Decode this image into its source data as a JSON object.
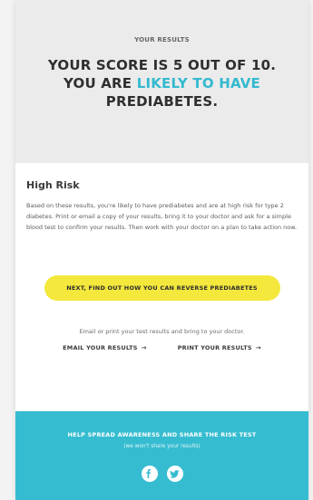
{
  "hero": {
    "kicker": "YOUR RESULTS",
    "title_line1": "YOUR SCORE IS 5 OUT OF 10.",
    "title_line2_prefix": "YOU ARE ",
    "title_line2_accent": "LIKELY TO HAVE",
    "title_line3": "PREDIABETES."
  },
  "risk": {
    "title": "High Risk",
    "body": "Based on these results, you're likely to have prediabetes and are at high risk for type 2 diabetes. Print or email a copy of your results, bring it to your doctor and ask for a simple blood test to confirm your results. Then work with your doctor on a plan to take action now."
  },
  "cta": {
    "button_label": "NEXT, FIND OUT HOW YOU CAN REVERSE PREDIABETES",
    "note": "Email or print your test results and bring to your doctor.",
    "email_link": "EMAIL YOUR RESULTS",
    "print_link": "PRINT YOUR RESULTS",
    "arrow": "→"
  },
  "share": {
    "title": "HELP SPREAD AWARENESS AND SHARE THE RISK TEST",
    "subtitle": "(we won't share your results)",
    "icons": [
      "facebook-icon",
      "twitter-icon"
    ]
  },
  "colors": {
    "accent": "#33b9cf",
    "cta_yellow": "#f4e83d",
    "share_bg": "#36bcd0"
  }
}
